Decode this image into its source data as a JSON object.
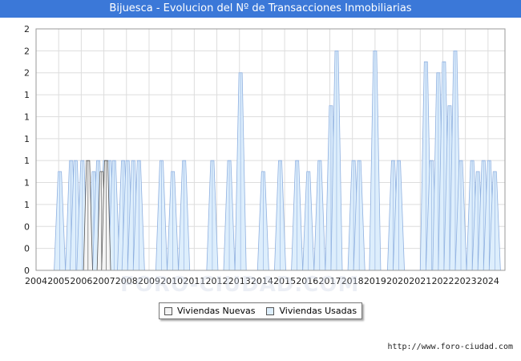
{
  "header": {
    "title": "Bijuesca - Evolucion del Nº de Transacciones Inmobiliarias"
  },
  "footer": {
    "url": "http://www.foro-ciudad.com"
  },
  "watermark": "FORO-CIUDAD.COM",
  "legend": {
    "nuevas": "Viviendas Nuevas",
    "usadas": "Viviendas Usadas"
  },
  "colors": {
    "title_bg": "#3b78d8",
    "usadas_fill": "#ddeefc",
    "usadas_stroke": "#8fb0e0",
    "nuevas_fill": "#f4f4f4",
    "nuevas_stroke": "#555555",
    "grid": "#dddddd"
  },
  "chart_data": {
    "type": "area",
    "xlim": [
      2004,
      2024.75
    ],
    "ylim": [
      0,
      2.2
    ],
    "y_tick_values": [
      0,
      0.2,
      0.4,
      0.6,
      0.8,
      1.0,
      1.2,
      1.4,
      1.6,
      1.8,
      2.0,
      2.2
    ],
    "y_tick_labels": [
      "0",
      "0",
      "0",
      "1",
      "1",
      "1",
      "1",
      "1",
      "1",
      "2",
      "2",
      "2"
    ],
    "x_tick_labels": [
      "2004",
      "2005",
      "2006",
      "2007",
      "2008",
      "2009",
      "2010",
      "2011",
      "2012",
      "2013",
      "2014",
      "2015",
      "2016",
      "2017",
      "2018",
      "2019",
      "2020",
      "2021",
      "2022",
      "2023",
      "2024"
    ],
    "grid": true,
    "legend_position": "bottom",
    "series": [
      {
        "name": "Viviendas Nuevas",
        "peaks": [
          {
            "x": 2006.3,
            "v": 1
          },
          {
            "x": 2006.9,
            "v": 0.9
          },
          {
            "x": 2007.1,
            "v": 1
          }
        ]
      },
      {
        "name": "Viviendas Usadas",
        "peaks": [
          {
            "x": 2005.05,
            "v": 0.9
          },
          {
            "x": 2005.55,
            "v": 1
          },
          {
            "x": 2005.75,
            "v": 1
          },
          {
            "x": 2006.05,
            "v": 1
          },
          {
            "x": 2006.55,
            "v": 0.9
          },
          {
            "x": 2006.75,
            "v": 1
          },
          {
            "x": 2007.05,
            "v": 1
          },
          {
            "x": 2007.25,
            "v": 1
          },
          {
            "x": 2007.45,
            "v": 1
          },
          {
            "x": 2007.85,
            "v": 1
          },
          {
            "x": 2008.05,
            "v": 1
          },
          {
            "x": 2008.3,
            "v": 1
          },
          {
            "x": 2008.55,
            "v": 1
          },
          {
            "x": 2009.55,
            "v": 1
          },
          {
            "x": 2010.05,
            "v": 0.9
          },
          {
            "x": 2010.55,
            "v": 1
          },
          {
            "x": 2011.8,
            "v": 1
          },
          {
            "x": 2012.55,
            "v": 1
          },
          {
            "x": 2013.05,
            "v": 1.8
          },
          {
            "x": 2014.05,
            "v": 0.9
          },
          {
            "x": 2014.8,
            "v": 1
          },
          {
            "x": 2015.55,
            "v": 1
          },
          {
            "x": 2016.05,
            "v": 0.9
          },
          {
            "x": 2016.55,
            "v": 1
          },
          {
            "x": 2017.05,
            "v": 1.5
          },
          {
            "x": 2017.3,
            "v": 2
          },
          {
            "x": 2018.05,
            "v": 1
          },
          {
            "x": 2018.3,
            "v": 1
          },
          {
            "x": 2019.0,
            "v": 2
          },
          {
            "x": 2019.8,
            "v": 1
          },
          {
            "x": 2020.05,
            "v": 1
          },
          {
            "x": 2021.25,
            "v": 1.9
          },
          {
            "x": 2021.5,
            "v": 1
          },
          {
            "x": 2021.8,
            "v": 1.8
          },
          {
            "x": 2022.05,
            "v": 1.9
          },
          {
            "x": 2022.3,
            "v": 1.5
          },
          {
            "x": 2022.55,
            "v": 2
          },
          {
            "x": 2022.8,
            "v": 1
          },
          {
            "x": 2023.3,
            "v": 1
          },
          {
            "x": 2023.55,
            "v": 0.9
          },
          {
            "x": 2023.8,
            "v": 1
          },
          {
            "x": 2024.05,
            "v": 1
          },
          {
            "x": 2024.3,
            "v": 0.9
          }
        ]
      }
    ]
  }
}
